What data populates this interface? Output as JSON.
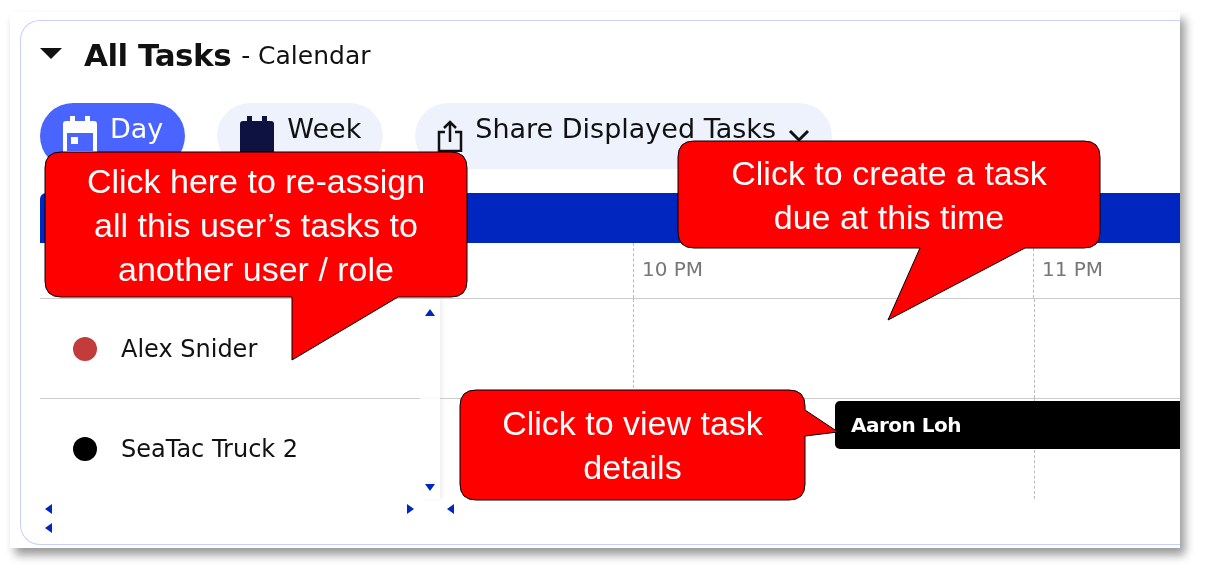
{
  "panel": {
    "title": "All Tasks",
    "subtitle": "- Calendar",
    "expanded": true
  },
  "view_buttons": [
    {
      "label": "Day",
      "selected": true,
      "kind": "calendar"
    },
    {
      "label": "Week",
      "selected": false,
      "kind": "calendar"
    },
    {
      "label": "Share Displayed Tasks",
      "selected": false,
      "kind": "share"
    }
  ],
  "time_columns": [
    "10 PM",
    "11 PM"
  ],
  "resources": [
    {
      "name": "Alex Snider",
      "color": "#c33c3c"
    },
    {
      "name": "SeaTac Truck 2",
      "color": "#000000",
      "tasks": [
        {
          "label": "Aaron Loh"
        }
      ]
    }
  ],
  "callouts": [
    {
      "text": "Click here to re-assign all this user’s tasks to another user / role"
    },
    {
      "text": "Click to create a task due at this time"
    },
    {
      "text": "Click to view task details"
    }
  ]
}
